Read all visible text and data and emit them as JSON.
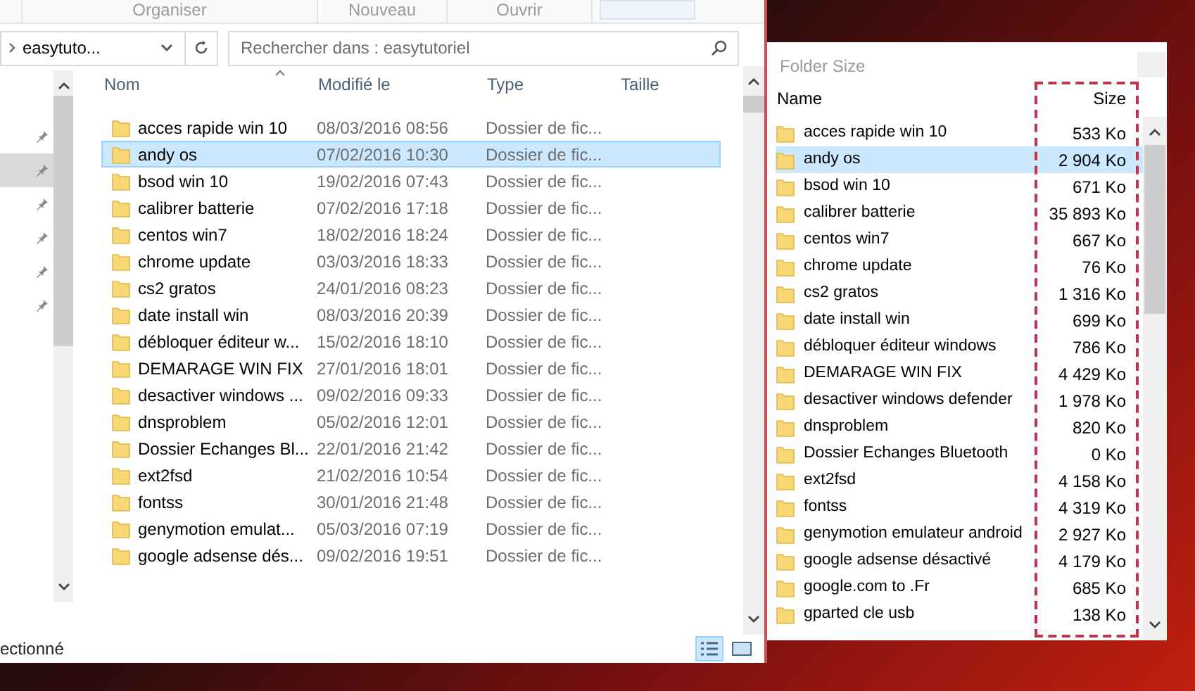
{
  "explorer": {
    "ribbon": [
      "Organiser",
      "Nouveau",
      "Ouvrir"
    ],
    "address": "easytuto...",
    "search": {
      "placeholder": "Rechercher dans : easytutoriel"
    },
    "quick_access": [
      {
        "selected": false
      },
      {
        "selected": true
      },
      {
        "selected": false
      },
      {
        "selected": false
      },
      {
        "selected": false
      },
      {
        "selected": false
      }
    ],
    "columns": [
      "Nom",
      "Modifié le",
      "Type",
      "Taille"
    ],
    "rows": [
      {
        "name": "acces rapide win 10",
        "modified": "08/03/2016 08:56",
        "type": "Dossier de fic...",
        "selected": false
      },
      {
        "name": "andy os",
        "modified": "07/02/2016 10:30",
        "type": "Dossier de fic...",
        "selected": true
      },
      {
        "name": "bsod win 10",
        "modified": "19/02/2016 07:43",
        "type": "Dossier de fic...",
        "selected": false
      },
      {
        "name": "calibrer batterie",
        "modified": "07/02/2016 17:18",
        "type": "Dossier de fic...",
        "selected": false
      },
      {
        "name": "centos win7",
        "modified": "18/02/2016 18:24",
        "type": "Dossier de fic...",
        "selected": false
      },
      {
        "name": "chrome update",
        "modified": "03/03/2016 18:33",
        "type": "Dossier de fic...",
        "selected": false
      },
      {
        "name": "cs2 gratos",
        "modified": "24/01/2016 08:23",
        "type": "Dossier de fic...",
        "selected": false
      },
      {
        "name": "date install win",
        "modified": "08/03/2016 20:39",
        "type": "Dossier de fic...",
        "selected": false
      },
      {
        "name": "débloquer éditeur w...",
        "modified": "15/02/2016 18:10",
        "type": "Dossier de fic...",
        "selected": false
      },
      {
        "name": "DEMARAGE WIN FIX",
        "modified": "27/01/2016 18:01",
        "type": "Dossier de fic...",
        "selected": false
      },
      {
        "name": "desactiver windows ...",
        "modified": "09/02/2016 09:33",
        "type": "Dossier de fic...",
        "selected": false
      },
      {
        "name": "dnsproblem",
        "modified": "05/02/2016 12:01",
        "type": "Dossier de fic...",
        "selected": false
      },
      {
        "name": "Dossier Echanges Bl...",
        "modified": "22/01/2016 21:42",
        "type": "Dossier de fic...",
        "selected": false
      },
      {
        "name": "ext2fsd",
        "modified": "21/02/2016 10:54",
        "type": "Dossier de fic...",
        "selected": false
      },
      {
        "name": "fontss",
        "modified": "30/01/2016 21:48",
        "type": "Dossier de fic...",
        "selected": false
      },
      {
        "name": "genymotion emulat...",
        "modified": "05/03/2016 07:19",
        "type": "Dossier de fic...",
        "selected": false
      },
      {
        "name": "google adsense dés...",
        "modified": "09/02/2016 19:51",
        "type": "Dossier de fic...",
        "selected": false
      }
    ],
    "status": "ectionné",
    "views": [
      {
        "kind": "details",
        "selected": true
      },
      {
        "kind": "thumbnails",
        "selected": false
      }
    ]
  },
  "folder_size": {
    "title": "Folder Size",
    "columns": [
      "Name",
      "Size"
    ],
    "rows": [
      {
        "name": "acces rapide win 10",
        "size": "533 Ko",
        "selected": false
      },
      {
        "name": "andy os",
        "size": "2 904 Ko",
        "selected": true
      },
      {
        "name": "bsod win 10",
        "size": "671 Ko",
        "selected": false
      },
      {
        "name": "calibrer batterie",
        "size": "35 893 Ko",
        "selected": false
      },
      {
        "name": "centos win7",
        "size": "667 Ko",
        "selected": false
      },
      {
        "name": "chrome update",
        "size": "76 Ko",
        "selected": false
      },
      {
        "name": "cs2 gratos",
        "size": "1 316 Ko",
        "selected": false
      },
      {
        "name": "date install win",
        "size": "699 Ko",
        "selected": false
      },
      {
        "name": "débloquer éditeur windows",
        "size": "786 Ko",
        "selected": false
      },
      {
        "name": "DEMARAGE WIN FIX",
        "size": "4 429 Ko",
        "selected": false
      },
      {
        "name": "desactiver windows defender",
        "size": "1 978 Ko",
        "selected": false
      },
      {
        "name": "dnsproblem",
        "size": "820 Ko",
        "selected": false
      },
      {
        "name": "Dossier Echanges Bluetooth",
        "size": "0 Ko",
        "selected": false
      },
      {
        "name": "ext2fsd",
        "size": "4 158 Ko",
        "selected": false
      },
      {
        "name": "fontss",
        "size": "4 319 Ko",
        "selected": false
      },
      {
        "name": "genymotion emulateur android",
        "size": "2 927 Ko",
        "selected": false
      },
      {
        "name": "google adsense désactivé",
        "size": "4 179 Ko",
        "selected": false
      },
      {
        "name": "google.com to .Fr",
        "size": "685 Ko",
        "selected": false
      },
      {
        "name": "gparted cle usb",
        "size": "138 Ko",
        "selected": false
      }
    ]
  }
}
